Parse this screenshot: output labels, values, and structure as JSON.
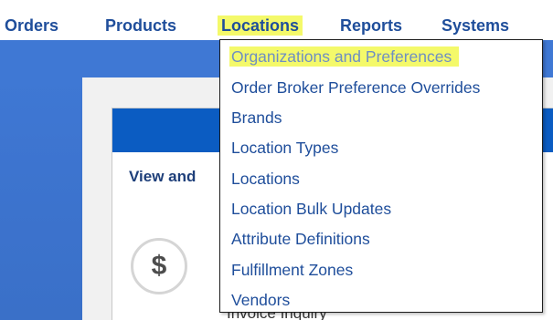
{
  "menubar": {
    "items": [
      {
        "label": "Orders"
      },
      {
        "label": "Products"
      },
      {
        "label": "Locations"
      },
      {
        "label": "Reports"
      },
      {
        "label": "Systems"
      }
    ],
    "active": "Locations",
    "highlight_color": "#f4f96a",
    "text_color": "#1f4e9b"
  },
  "background": {
    "card_title": "View and",
    "icon": "dollar-icon",
    "icon_glyph": "$",
    "partial_text": "Invoice Inquiry"
  },
  "dropdown": {
    "items": [
      {
        "label": "Organizations and Preferences"
      },
      {
        "label": "Order Broker Preference Overrides"
      },
      {
        "label": "Brands"
      },
      {
        "label": "Location Types"
      },
      {
        "label": "Locations"
      },
      {
        "label": "Location Bulk Updates"
      },
      {
        "label": "Attribute Definitions"
      },
      {
        "label": "Fulfillment Zones"
      },
      {
        "label": "Vendors"
      }
    ],
    "highlighted_item": "Organizations and Preferences"
  }
}
